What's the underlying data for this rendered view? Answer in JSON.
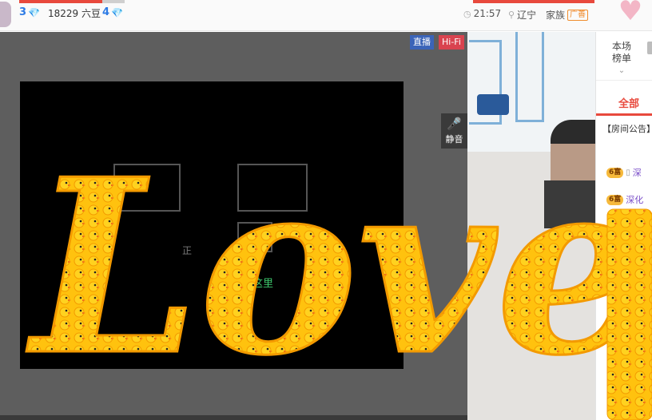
{
  "header": {
    "level_left": "3",
    "beans": "18229 六豆",
    "level_right": "4",
    "time": "21:57",
    "location": "辽宁",
    "family_label": "家族",
    "ad_badge": "广善"
  },
  "player": {
    "badge_live": "直播",
    "badge_hifi": "Hi-Fi",
    "mute_label": "静音",
    "hint_top": "正",
    "hint_bottom": "搜到这里"
  },
  "right_panel": {
    "rank_tab_line1": "本场",
    "rank_tab_line2": "榜单",
    "tab_all": "全部",
    "announcement": "【房间公告】",
    "chat": [
      {
        "vip": "6富",
        "user": "深"
      },
      {
        "vip": "6富",
        "user": "深化"
      }
    ]
  },
  "overlay": {
    "text": "Love"
  },
  "colors": {
    "accent_red": "#e8493d",
    "level_blue": "#2d7be5",
    "duck_yellow": "#ffc20e"
  },
  "icons": {
    "gem": "diamond-icon",
    "clock": "clock-icon",
    "location": "location-pin-icon",
    "mic": "microphone-icon",
    "heart": "heart-icon"
  }
}
